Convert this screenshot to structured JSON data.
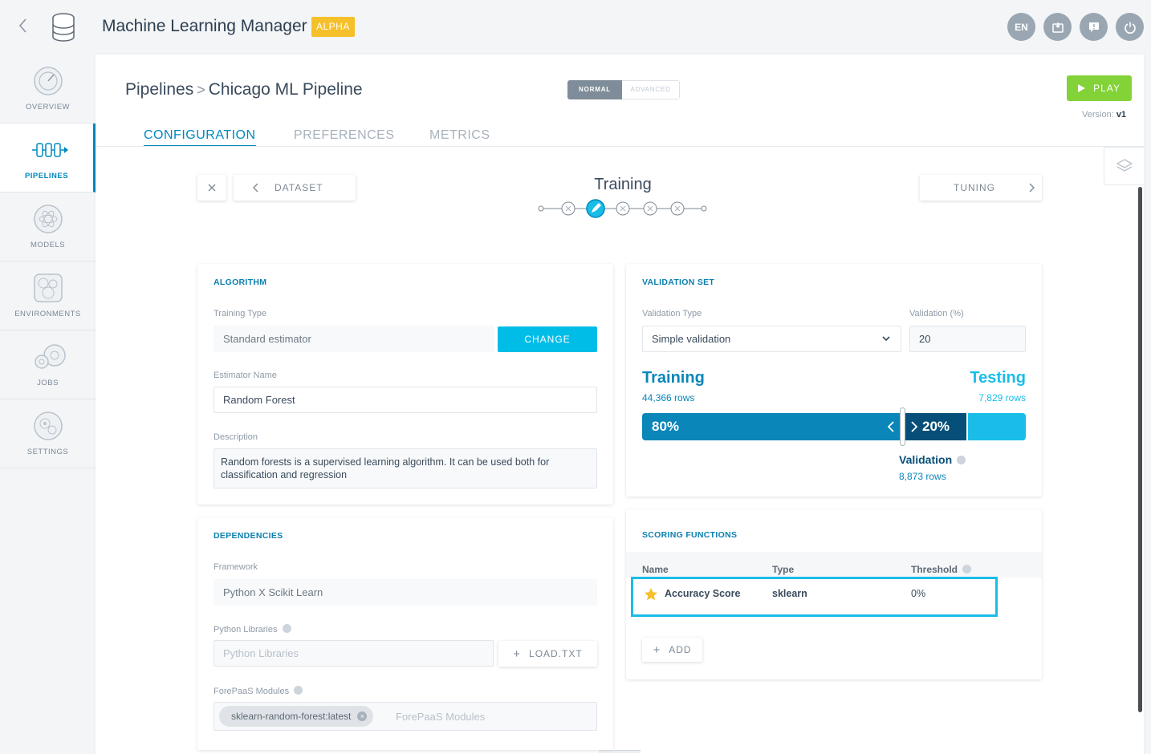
{
  "app": {
    "title": "Machine Learning Manager",
    "badge": "ALPHA"
  },
  "top_icons": [
    {
      "name": "language",
      "label": "EN"
    },
    {
      "name": "deploy-icon",
      "label": ""
    },
    {
      "name": "feedback-icon",
      "label": ""
    },
    {
      "name": "power-icon",
      "label": ""
    }
  ],
  "sidebar": {
    "items": [
      {
        "label": "OVERVIEW",
        "icon": "gauge-icon"
      },
      {
        "label": "PIPELINES",
        "icon": "pipeline-icon",
        "active": true
      },
      {
        "label": "MODELS",
        "icon": "atom-icon"
      },
      {
        "label": "ENVIRONMENTS",
        "icon": "environment-icon"
      },
      {
        "label": "JOBS",
        "icon": "gears-icon"
      },
      {
        "label": "SETTINGS",
        "icon": "settings-icon"
      }
    ]
  },
  "header": {
    "breadcrumb_root": "Pipelines",
    "breadcrumb_current": "Chicago ML Pipeline",
    "mode_normal": "NORMAL",
    "mode_advanced": "ADVANCED",
    "play_label": "PLAY",
    "version_label": "Version:",
    "version_value": "v1"
  },
  "tabs": [
    {
      "label": "CONFIGURATION",
      "active": true
    },
    {
      "label": "PREFERENCES"
    },
    {
      "label": "METRICS"
    }
  ],
  "wizard": {
    "prev_label": "DATASET",
    "next_label": "TUNING",
    "step_title": "Training",
    "steps_total": 5,
    "current_step": 2
  },
  "algorithm": {
    "title": "ALGORITHM",
    "training_type_label": "Training Type",
    "training_type_value": "Standard estimator",
    "change_label": "CHANGE",
    "estimator_label": "Estimator Name",
    "estimator_value": "Random Forest",
    "description_label": "Description",
    "description_value": "Random forests is a supervised learning algorithm. It can be used both for classification and regression"
  },
  "dependencies": {
    "title": "DEPENDENCIES",
    "framework_label": "Framework",
    "framework_value": "Python X Scikit Learn",
    "libraries_label": "Python Libraries",
    "libraries_placeholder": "Python Libraries",
    "load_label": "LOAD.TXT",
    "modules_label": "ForePaaS Modules",
    "module_chip": "sklearn-random-forest:latest",
    "modules_placeholder": "ForePaaS Modules"
  },
  "validation": {
    "title": "VALIDATION SET",
    "type_label": "Validation Type",
    "type_value": "Simple validation",
    "percent_label": "Validation (%)",
    "percent_value": "20",
    "training_label": "Training",
    "training_rows": "44,366 rows",
    "testing_label": "Testing",
    "testing_rows": "7,829 rows",
    "train_pct": "80%",
    "val_pct": "20%",
    "validation_label": "Validation",
    "validation_rows": "8,873 rows",
    "colors": {
      "train": "#0a86b9",
      "validation": "#064f78",
      "test": "#19bde8"
    }
  },
  "scoring": {
    "title": "SCORING FUNCTIONS",
    "col_name": "Name",
    "col_type": "Type",
    "col_threshold": "Threshold",
    "rows": [
      {
        "name": "Accuracy Score",
        "type": "sklearn",
        "threshold": "0%",
        "starred": true
      }
    ],
    "add_label": "ADD"
  }
}
